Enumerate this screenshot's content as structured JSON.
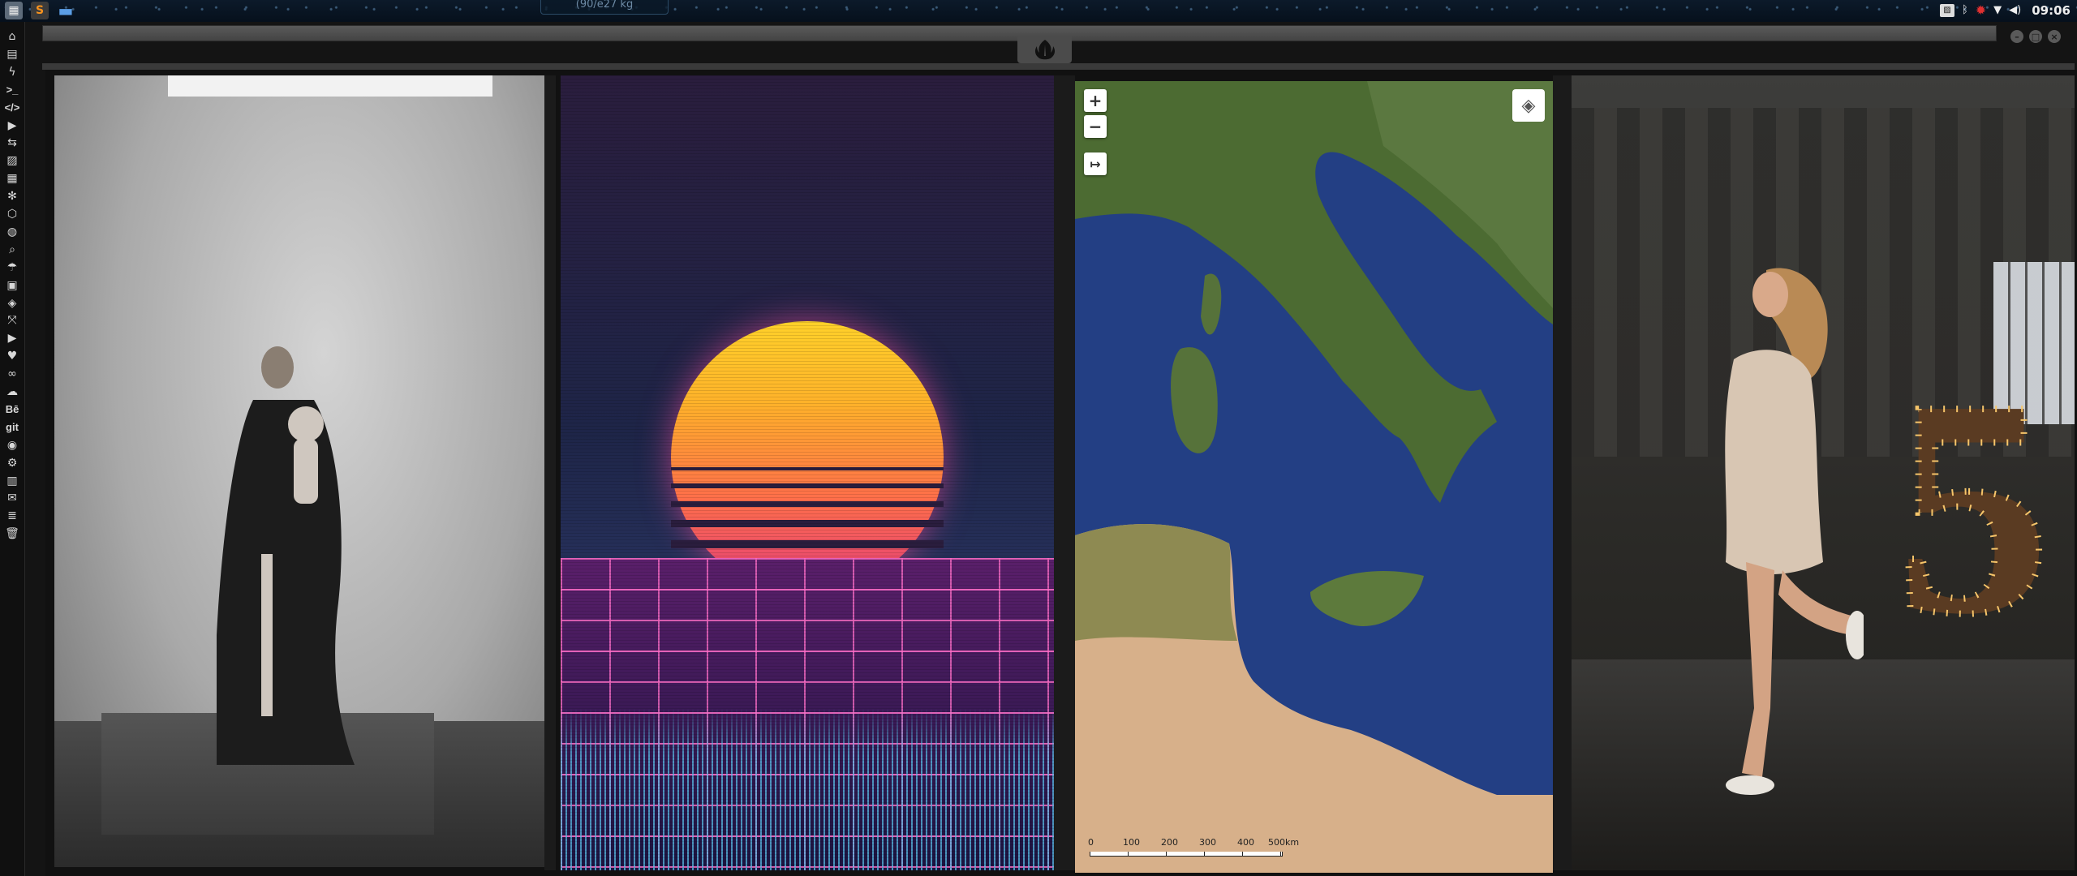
{
  "topbar": {
    "search_text": "(90/e27 kg",
    "clock": "09:06",
    "left_icons": [
      "workspace-icon",
      "sublime-text-icon",
      "files-folder-icon"
    ],
    "status_icons": [
      "photo-icon",
      "bluetooth-icon",
      "red-alert-icon",
      "wifi-icon",
      "volume-icon"
    ]
  },
  "sidebar": {
    "items": [
      {
        "name": "home",
        "glyph": "⌂"
      },
      {
        "name": "document",
        "glyph": "▤"
      },
      {
        "name": "flash",
        "glyph": "ϟ"
      },
      {
        "name": "terminal",
        "glyph": ">_"
      },
      {
        "name": "code",
        "glyph": "</>"
      },
      {
        "name": "play",
        "glyph": "▶"
      },
      {
        "name": "translate",
        "glyph": "⇆"
      },
      {
        "name": "image",
        "glyph": "▨"
      },
      {
        "name": "news",
        "glyph": "▦"
      },
      {
        "name": "react",
        "glyph": "✻"
      },
      {
        "name": "network",
        "glyph": "⬡"
      },
      {
        "name": "globe",
        "glyph": "◍"
      },
      {
        "name": "search",
        "glyph": "⌕"
      },
      {
        "name": "weather",
        "glyph": "☂"
      },
      {
        "name": "contacts",
        "glyph": "▣"
      },
      {
        "name": "diff",
        "glyph": "◈"
      },
      {
        "name": "expand",
        "glyph": "⤧"
      },
      {
        "name": "youtube",
        "glyph": "▶"
      },
      {
        "name": "heart",
        "glyph": "♥"
      },
      {
        "name": "creative-cloud",
        "glyph": "∞"
      },
      {
        "name": "cloud",
        "glyph": "☁"
      },
      {
        "name": "behance",
        "glyph": "Bē"
      },
      {
        "name": "git",
        "glyph": "git"
      },
      {
        "name": "github",
        "glyph": "◉"
      },
      {
        "name": "settings-cluster",
        "glyph": "⚙"
      },
      {
        "name": "map",
        "glyph": "▥"
      },
      {
        "name": "mail",
        "glyph": "✉"
      },
      {
        "name": "server",
        "glyph": "≣"
      },
      {
        "name": "trash",
        "glyph": "🗑"
      }
    ]
  },
  "window": {
    "controls": [
      "–",
      "□",
      "×"
    ],
    "logo": "rebel-alliance-icon"
  },
  "map": {
    "zoom_in": "+",
    "zoom_out": "−",
    "measure": "↦",
    "layers_icon": "layers-icon",
    "scale_labels": [
      "0",
      "100",
      "200",
      "300",
      "400",
      "500km"
    ]
  },
  "photos": {
    "panel4_sign": "5"
  }
}
